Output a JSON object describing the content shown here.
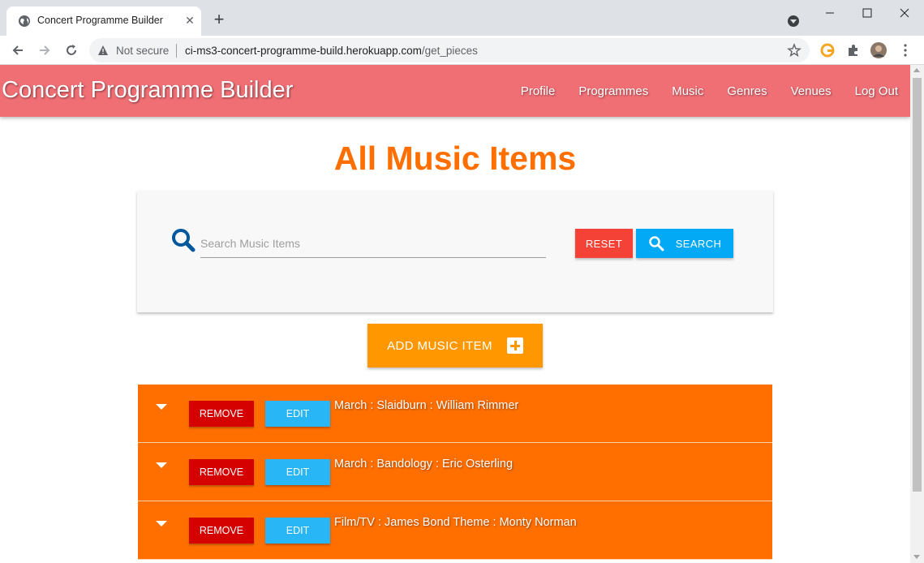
{
  "browser": {
    "tab_title": "Concert Programme Builder",
    "tab_close": "✕",
    "new_tab": "+",
    "not_secure": "Not secure",
    "url_host": "ci-ms3-concert-programme-build.herokuapp.com",
    "url_path": "/get_pieces"
  },
  "navbar": {
    "brand": "Concert Programme Builder",
    "links": [
      "Profile",
      "Programmes",
      "Music",
      "Genres",
      "Venues",
      "Log Out"
    ]
  },
  "page": {
    "title": "All Music Items"
  },
  "search": {
    "placeholder": "Search Music Items",
    "value": "",
    "reset_label": "RESET",
    "search_label": "SEARCH"
  },
  "add_button": {
    "label": "ADD MUSIC ITEM"
  },
  "items": [
    {
      "title": "March : Slaidburn : William Rimmer",
      "remove_label": "REMOVE",
      "edit_label": "EDIT"
    },
    {
      "title": "March : Bandology : Eric Osterling",
      "remove_label": "REMOVE",
      "edit_label": "EDIT"
    },
    {
      "title": "Film/TV : James Bond Theme : Monty Norman",
      "remove_label": "REMOVE",
      "edit_label": "EDIT"
    }
  ],
  "colors": {
    "navbar": "#ef6f75",
    "title": "#ff6f00",
    "reset": "#f44336",
    "search": "#03a9f4",
    "add": "#ff9800",
    "item": "#ff6f00",
    "remove": "#d50000",
    "edit": "#29b6f6"
  }
}
